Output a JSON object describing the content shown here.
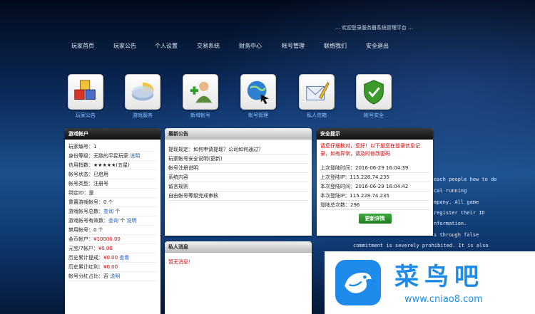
{
  "top_note": "... 欢迎登录服务器系统管理平台 ...",
  "nav": [
    "玩家首页",
    "玩家公告",
    "个人设置",
    "交易系统",
    "财务中心",
    "帐号管理",
    "联络我们",
    "安全退出"
  ],
  "quick_icons": [
    {
      "label": "玩家公告",
      "icon": "cubes-icon"
    },
    {
      "label": "游戏服务",
      "icon": "pie-chart-icon"
    },
    {
      "label": "新增帐号",
      "icon": "add-user-icon"
    },
    {
      "label": "帐号管理",
      "icon": "globe-cursor-icon"
    },
    {
      "label": "私人信箱",
      "icon": "mail-icon"
    },
    {
      "label": "帐号安全",
      "icon": "shield-icon"
    }
  ],
  "account_panel": {
    "title": "游戏帐户",
    "rows": [
      {
        "label": "玩家编号：",
        "value": "1"
      },
      {
        "label": "身份等级：",
        "value": "无敌的平民玩家",
        "link": "说明"
      },
      {
        "label": "信用指数：",
        "value": "★★★★★(五星)"
      },
      {
        "label": "帐号状态：",
        "value": "已启用"
      },
      {
        "label": "帐号类型：",
        "value": "注册号"
      },
      {
        "label": "绑定ID：",
        "value": "是"
      },
      {
        "label": "重置游戏帐号：",
        "value": "0 个"
      },
      {
        "label": "游戏帐号总数：",
        "link": "查询",
        "value": "个"
      },
      {
        "label": "游戏帐号有效数：",
        "link": "查询",
        "value": "个",
        "link2": "说明"
      },
      {
        "label": "禁用帐号：",
        "value": "0 个"
      },
      {
        "label": "金币帐户：",
        "value": "¥10000.00",
        "red": true
      },
      {
        "label": "元宝/7帐户：",
        "value": "¥0.00",
        "red": true
      },
      {
        "label": "历史累计提成：",
        "value": "¥0.00",
        "red": true,
        "link": "查看"
      },
      {
        "label": "历史累计红利：",
        "value": "¥0.00",
        "red": true
      },
      {
        "label": "帐号分红占比：",
        "value": "否",
        "link": "说明"
      }
    ]
  },
  "announce_panel": {
    "title": "最新公告",
    "items": [
      "提现规定：如何申请提现？公司如何通过？",
      "玩家帐号安全说明(更新)",
      "帐号注册说明",
      "系统内容",
      "留言规则",
      "自由帐号等级完成审核"
    ]
  },
  "message_panel": {
    "title": "私人消息",
    "text": "暂无消息！"
  },
  "security_panel": {
    "title": "安全提示",
    "warning": "请您仔细核对，您好！以下是您在登录信息记录，如有异常，请及时修改密码",
    "rows": [
      {
        "label": "上次登陆时间：",
        "value": "2016-06-29 16:04:39"
      },
      {
        "label": "上次登陆IP：",
        "value": "115.228.74.235"
      },
      {
        "label": "本次登陆时间：",
        "value": "2016-06-29 16:04:42"
      },
      {
        "label": "本次登陆IP：",
        "value": "115.228.74.235"
      },
      {
        "label": "登陆总次数：",
        "value": "296"
      }
    ],
    "button": "更新详情"
  },
  "bg_text": [
    "each people how to do",
    "cal running",
    "mpany. All game",
    "register their ID",
    "nformation.",
    "s through false",
    "commitment is severely prohibited. It is also"
  ],
  "brand": {
    "name": "菜鸟吧",
    "url": "www.cniao8.com"
  },
  "colors": {
    "accent_blue": "#1e8bea",
    "link_blue": "#1f5fbf",
    "warn_red": "#d00000",
    "button_green": "#2a962a"
  }
}
